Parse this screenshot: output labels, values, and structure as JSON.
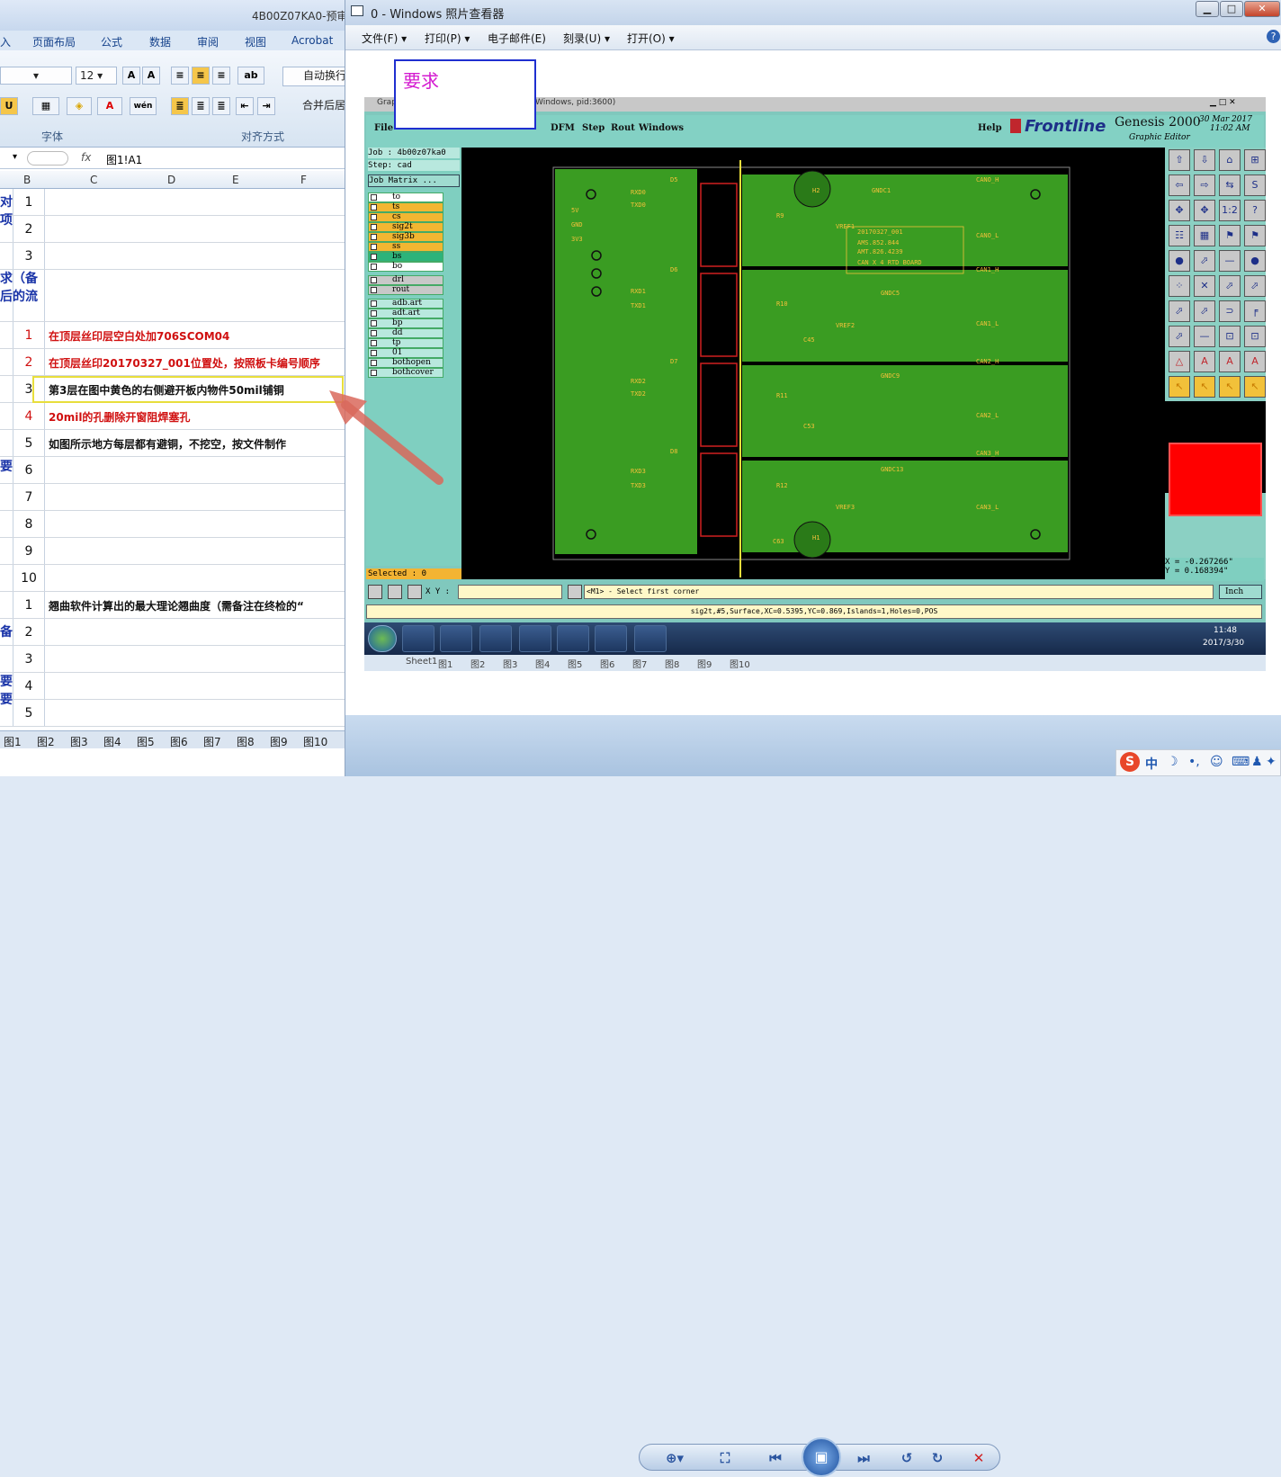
{
  "excel": {
    "title": "4B00Z07KA0-预审",
    "tabs": [
      "入",
      "页面布局",
      "公式",
      "数据",
      "审阅",
      "视图",
      "Acrobat"
    ],
    "font_size": "12",
    "wrap_label": "自动换行",
    "merge_label": "合并后居",
    "group_font": "字体",
    "group_align": "对齐方式",
    "name_box": "",
    "fx": "fx",
    "formula": "图1!A1",
    "columns": [
      "B",
      "C",
      "D",
      "E",
      "F"
    ],
    "left_labels": [
      "对",
      "项",
      "求（备",
      "后的流",
      "要",
      "备",
      "要",
      "要"
    ],
    "rows": [
      {
        "num": "1",
        "text": "",
        "color": "#111"
      },
      {
        "num": "2",
        "text": "",
        "color": "#111"
      },
      {
        "num": "3",
        "text": "",
        "color": "#111"
      },
      {
        "num": "",
        "text": "",
        "color": "#111"
      },
      {
        "num": "1",
        "text": "在顶层丝印层空白处加706SCOM04",
        "color": "#d01010"
      },
      {
        "num": "2",
        "text": "在顶层丝印20170327_001位置处，按照板卡编号顺序",
        "color": "#d01010"
      },
      {
        "num": "3",
        "text": "第3层在图中黄色的右侧避开板内物件50mil铺铜",
        "color": "#111"
      },
      {
        "num": "4",
        "text": "20mil的孔删除开窗阻焊塞孔",
        "color": "#d01010"
      },
      {
        "num": "5",
        "text": "如图所示地方每层都有避铜，不挖空，按文件制作",
        "color": "#111"
      },
      {
        "num": "6",
        "text": "",
        "color": "#111"
      },
      {
        "num": "7",
        "text": "",
        "color": "#111"
      },
      {
        "num": "8",
        "text": "",
        "color": "#111"
      },
      {
        "num": "9",
        "text": "",
        "color": "#111"
      },
      {
        "num": "10",
        "text": "",
        "color": "#111"
      },
      {
        "num": "1",
        "text": "翘曲软件计算出的最大理论翘曲度（需备注在终检的“",
        "color": "#111"
      },
      {
        "num": "2",
        "text": "",
        "color": "#111"
      },
      {
        "num": "3",
        "text": "",
        "color": "#111"
      },
      {
        "num": "4",
        "text": "",
        "color": "#111"
      },
      {
        "num": "5",
        "text": "",
        "color": "#111"
      }
    ],
    "sheets": [
      "图1",
      "图2",
      "图3",
      "图4",
      "图5",
      "图6",
      "图7",
      "图8",
      "图9",
      "图10"
    ]
  },
  "viewer": {
    "title": "0 - Windows 照片查看器",
    "menu": [
      "文件(F) ▾",
      "打印(P) ▾",
      "电子邮件(E)",
      "刻录(U) ▾",
      "打开(O) ▾"
    ],
    "help": "?",
    "annotation": "要求"
  },
  "genesis": {
    "window_title": "Grap",
    "window_title_tail": "Windows, pid:3600)",
    "menu": [
      "File",
      "DFM",
      "Step",
      "Rout",
      "Windows",
      "Help"
    ],
    "brand": "Frontline",
    "product": "Genesis 2000",
    "subtitle": "Graphic Editor",
    "date": "30 Mar 2017",
    "time": "11:02 AM",
    "job": "Job : 4b00z07ka0",
    "step": "Step: cad",
    "job_matrix": "Job Matrix ...",
    "layers": [
      "to",
      "ts",
      "cs",
      "sig2t",
      "sig3b",
      "ss",
      "bs",
      "bo",
      "drl",
      "rout",
      "adb.art",
      "adt.art",
      "bp",
      "dd",
      "tp",
      "01",
      "bothopen",
      "bothcover"
    ],
    "selected": "Selected : 0",
    "xy_label": "X Y :",
    "prompt": "<M1> - Select first corner",
    "units": "Inch",
    "coord_x": "X = -0.267266\"",
    "coord_y": "Y = 0.168394\"",
    "status": "sig2t,#5,Surface,XC=0.5395,YC=0.869,Islands=1,Holes=0,POS",
    "board_labels": [
      "20170327_001",
      "AMS.852.844",
      "AMT.826.4239",
      "CAN X 4 RTD BOARD",
      "GNDC1",
      "GNDC5",
      "GNDC9",
      "GNDC13",
      "VREF1",
      "VREF2",
      "VREF3",
      "H1",
      "H2",
      "C45",
      "C53",
      "C63",
      "R9",
      "R10",
      "R11",
      "R12",
      "CANO_H",
      "CANO_L",
      "CAN1_H",
      "CAN1_L",
      "CAN2_H",
      "CAN2_L",
      "CAN3_H",
      "CAN3_L",
      "RXD0",
      "TXD0",
      "RXD1",
      "TXD1",
      "RXD2",
      "TXD2",
      "RXD3",
      "TXD3",
      "D5",
      "D6",
      "D7",
      "D8",
      "5V",
      "GND",
      "3V3"
    ]
  },
  "taskbar": {
    "clock": "11:48",
    "date": "2017/3/30",
    "sheet_tabs": [
      "Sheet1",
      "图1",
      "图2",
      "图3",
      "图4",
      "图5",
      "图6",
      "图7",
      "图8",
      "图9",
      "图10"
    ]
  },
  "ime": {
    "label": "中"
  }
}
